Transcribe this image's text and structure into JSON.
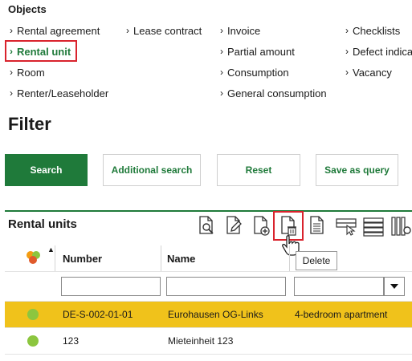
{
  "objects": {
    "title": "Objects",
    "items": [
      {
        "label": "Rental agreement"
      },
      {
        "label": "Lease contract"
      },
      {
        "label": "Invoice"
      },
      {
        "label": "Checklists"
      },
      {
        "label": "Rental unit",
        "active": true
      },
      {
        "label": "Partial amount"
      },
      {
        "label": "Defect indicat"
      },
      {
        "label": "Room"
      },
      {
        "label": "Consumption"
      },
      {
        "label": "Vacancy"
      },
      {
        "label": "Renter/Leaseholder"
      },
      {
        "label": "General consumption"
      }
    ]
  },
  "filter": {
    "title": "Filter",
    "buttons": {
      "search": "Search",
      "additional_search": "Additional search",
      "reset": "Reset",
      "save_as_query": "Save as query"
    }
  },
  "grid": {
    "title": "Rental units",
    "toolbar_icons": [
      "view-document-icon",
      "edit-document-icon",
      "add-document-icon",
      "delete-document-icon",
      "document-icon",
      "select-columns-icon",
      "list-rows-icon",
      "settings-columns-icon"
    ],
    "tooltip": "Delete",
    "columns": {
      "number": "Number",
      "name": "Name"
    },
    "rows": [
      {
        "number": "DE-S-002-01-01",
        "name": "Eurohausen OG-Links",
        "type": "4-bedroom apartment",
        "status_color": "#8cc63f",
        "selected": true
      },
      {
        "number": "123",
        "name": "Mieteinheit 123",
        "type": "",
        "status_color": "#8cc63f",
        "selected": false
      }
    ]
  },
  "colors": {
    "accent": "#1f7a3a",
    "highlight": "#d9232d",
    "selected_row": "#f0c21b"
  }
}
